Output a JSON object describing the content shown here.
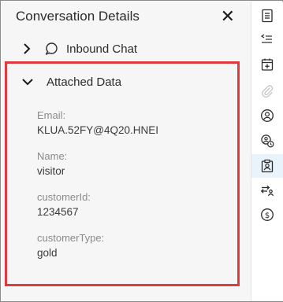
{
  "panel": {
    "title": "Conversation Details",
    "close_symbol": "✕"
  },
  "inbound": {
    "label": "Inbound Chat",
    "expanded": false
  },
  "attached_data": {
    "label": "Attached Data",
    "expanded": true,
    "fields": [
      {
        "key": "Email:",
        "value": "KLUA.52FY@4Q20.HNEI"
      },
      {
        "key": "Name:",
        "value": "visitor"
      },
      {
        "key": "customerId:",
        "value": "1234567"
      },
      {
        "key": "customerType:",
        "value": "gold"
      }
    ]
  },
  "highlight_color": "#e0393e",
  "rail": {
    "icons": [
      "contact-card-icon",
      "list-indent-icon",
      "calendar-add-icon",
      "paperclip-icon",
      "user-circle-icon",
      "user-clock-icon",
      "clipboard-user-icon",
      "user-transfer-icon",
      "dollar-circle-icon"
    ],
    "active_icon": "clipboard-user-icon"
  }
}
